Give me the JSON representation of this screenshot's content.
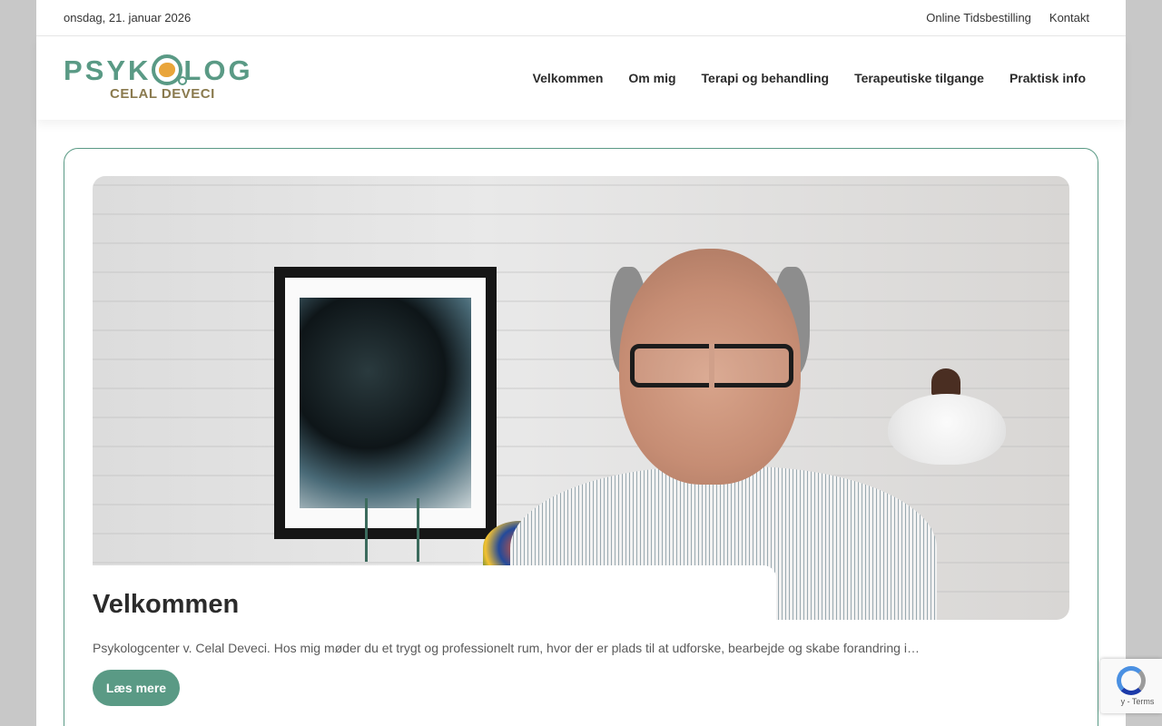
{
  "topbar": {
    "date": "onsdag, 21. januar 2026",
    "links": [
      "Online Tidsbestilling",
      "Kontakt"
    ]
  },
  "logo": {
    "main_left": "PSYK",
    "main_right": "LOG",
    "sub": "CELAL DEVECI"
  },
  "nav": {
    "items": [
      "Velkommen",
      "Om mig",
      "Terapi og behandling",
      "Terapeutiske tilgange",
      "Praktisk info"
    ]
  },
  "post": {
    "title": "Velkommen",
    "excerpt": "Psykologcenter v. Celal Deveci. Hos mig møder du et trygt og professionelt rum, hvor der er plads til at udforske, bearbejde og skabe forandring i…",
    "button": "Læs mere"
  },
  "recaptcha": {
    "terms": "y - Terms"
  },
  "colors": {
    "accent": "#5a9a85",
    "logo_sub": "#8a7a4e"
  }
}
